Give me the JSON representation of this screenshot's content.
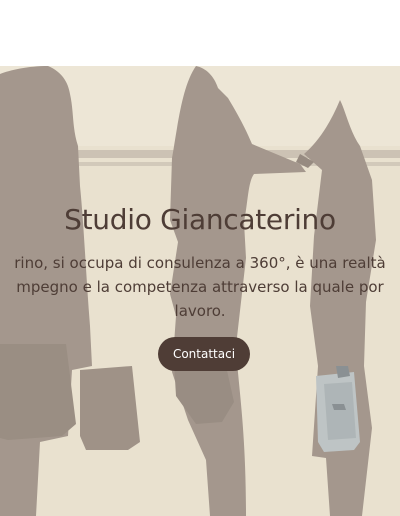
{
  "hero": {
    "title": "Studio Giancaterino",
    "subtitle_lines": [
      "rino, si occupa di consulenza a 360°, è una realtà",
      "mpegno e la competenza attraverso la quale por",
      "lavoro."
    ],
    "cta_label": "Contattaci"
  },
  "colors": {
    "hero_background": "#e9e1cf",
    "silhouette": "#9a8d83",
    "text": "#4e3d36",
    "button": "#4f3d36",
    "button_text": "#ffffff"
  },
  "icons": {
    "background": "business-people-silhouettes-image"
  }
}
